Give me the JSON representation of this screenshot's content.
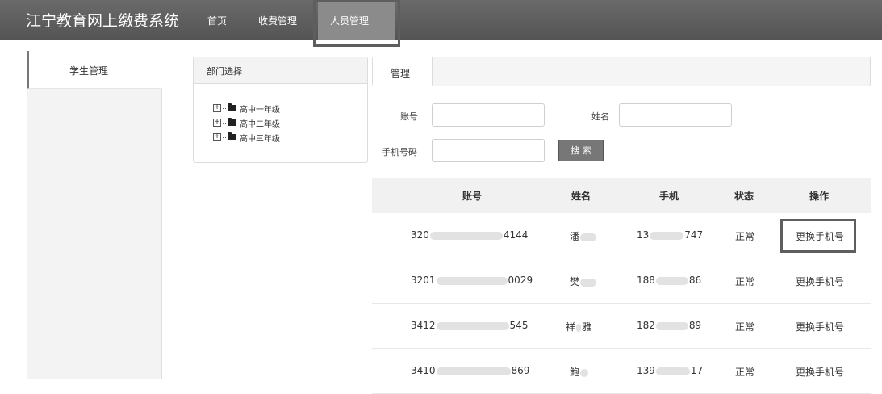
{
  "header": {
    "brand": "江宁教育网上缴费系统",
    "nav": [
      {
        "label": "首页"
      },
      {
        "label": "收费管理"
      },
      {
        "label": "人员管理",
        "active": true
      }
    ]
  },
  "sidebar": {
    "items": [
      {
        "label": "学生管理",
        "active": true
      }
    ]
  },
  "dept_panel": {
    "title": "部门选择",
    "tree": [
      {
        "label": "高中一年级",
        "expander": "+"
      },
      {
        "label": "高中二年级",
        "expander": "+"
      },
      {
        "label": "高中三年级",
        "expander": "+"
      }
    ]
  },
  "manage_panel": {
    "tab": "管理",
    "form": {
      "account_label": "账号",
      "account_value": "",
      "name_label": "姓名",
      "name_value": "",
      "phone_label": "手机号码",
      "phone_value": "",
      "search_label": "搜 索"
    },
    "table": {
      "columns": [
        "账号",
        "姓名",
        "手机",
        "状态",
        "操作"
      ],
      "rows": [
        {
          "account_prefix": "320",
          "account_suffix": "4144",
          "name_first": "潘",
          "name_last": "",
          "phone_prefix": "13",
          "phone_suffix": "747",
          "status": "正常",
          "action": "更换手机号",
          "highlighted": true
        },
        {
          "account_prefix": "3201",
          "account_suffix": "0029",
          "name_first": "樊",
          "name_last": "",
          "phone_prefix": "188",
          "phone_suffix": "86",
          "status": "正常",
          "action": "更换手机号",
          "highlighted": false
        },
        {
          "account_prefix": "3412",
          "account_suffix": "545",
          "name_first": "祥",
          "name_last": "雅",
          "phone_prefix": "182",
          "phone_suffix": "89",
          "status": "正常",
          "action": "更换手机号",
          "highlighted": false
        },
        {
          "account_prefix": "3410",
          "account_suffix": "869",
          "name_first": "鲍",
          "name_last": "",
          "phone_prefix": "139",
          "phone_suffix": "17",
          "status": "正常",
          "action": "更换手机号",
          "highlighted": false
        }
      ]
    }
  }
}
